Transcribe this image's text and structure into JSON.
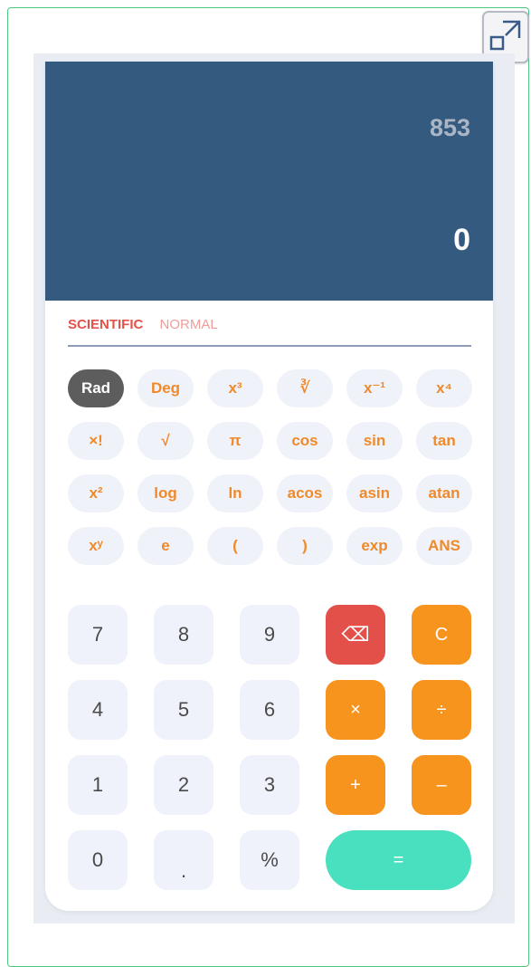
{
  "display": {
    "expression": "853",
    "result": "0",
    "bg_color": "#355a7f"
  },
  "modes": [
    {
      "label": "SCIENTIFIC",
      "active": true
    },
    {
      "label": "NORMAL",
      "active": false
    }
  ],
  "scientific_keys": [
    "Rad",
    "Deg",
    "x³",
    "∛",
    "x⁻¹",
    "x⁴",
    "×!",
    "√",
    "π",
    "cos",
    "sin",
    "tan",
    "x²",
    "log",
    "ln",
    "acos",
    "asin",
    "atan",
    "xʸ",
    "e",
    "(",
    ")",
    "exp",
    "ANS"
  ],
  "keypad": {
    "row1": [
      "7",
      "8",
      "9",
      "⌫",
      "C"
    ],
    "row2": [
      "4",
      "5",
      "6",
      "×",
      "÷"
    ],
    "row3": [
      "1",
      "2",
      "3",
      "+",
      "–"
    ],
    "row4": [
      "0",
      ".",
      "%",
      "="
    ]
  },
  "colors": {
    "accent_orange": "#f7941d",
    "delete_red": "#e3504a",
    "equals_green": "#49e0bf",
    "active_mode": "#e4514a"
  }
}
